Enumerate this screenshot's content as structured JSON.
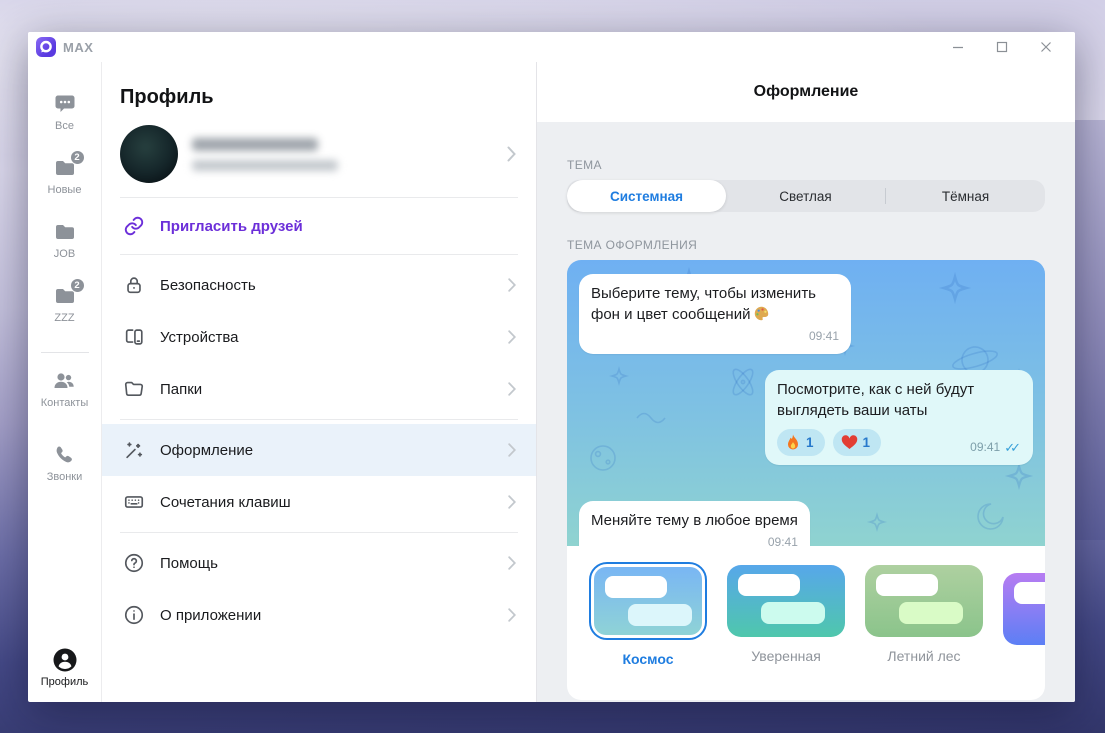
{
  "window": {
    "app_title": "MAX"
  },
  "nav_rail": {
    "items": [
      {
        "label": "Все",
        "icon": "chat-bubble-icon",
        "badge": ""
      },
      {
        "label": "Новые",
        "icon": "folder-icon",
        "badge": "2"
      },
      {
        "label": "JOB",
        "icon": "folder-icon",
        "badge": ""
      },
      {
        "label": "ZZZ",
        "icon": "folder-icon",
        "badge": "2"
      },
      {
        "label": "Контакты",
        "icon": "contacts-icon",
        "badge": ""
      },
      {
        "label": "Звонки",
        "icon": "phone-icon",
        "badge": ""
      }
    ],
    "profile_item": {
      "label": "Профиль",
      "icon": "person-circle-icon",
      "active": true
    }
  },
  "profile_panel": {
    "title": "Профиль",
    "user": {
      "name_hidden": true,
      "phone_hidden": true
    },
    "invite": {
      "label": "Пригласить друзей",
      "icon": "link-icon"
    },
    "menu": [
      {
        "label": "Безопасность",
        "icon": "lock-icon"
      },
      {
        "label": "Устройства",
        "icon": "devices-icon"
      },
      {
        "label": "Папки",
        "icon": "folder-outline-icon"
      },
      {
        "label": "Оформление",
        "icon": "magic-wand-icon",
        "active": true
      },
      {
        "label": "Сочетания клавиш",
        "icon": "keyboard-icon"
      },
      {
        "label": "Помощь",
        "icon": "help-icon"
      },
      {
        "label": "О приложении",
        "icon": "info-icon"
      }
    ]
  },
  "appearance": {
    "title": "Оформление",
    "theme_label": "ТЕМА",
    "tabs": [
      {
        "label": "Системная",
        "selected": true
      },
      {
        "label": "Светлая",
        "selected": false
      },
      {
        "label": "Тёмная",
        "selected": false
      }
    ],
    "preview_label": "ТЕМА ОФОРМЛЕНИЯ",
    "messages": [
      {
        "direction": "in",
        "text": "Выберите тему, чтобы изменить фон и цвет сообщений",
        "emoji": "🎨",
        "time": "09:41"
      },
      {
        "direction": "out",
        "text": "Посмотрите, как с ней будут выглядеть ваши чаты",
        "time": "09:41",
        "read_mark": "✓✓",
        "reactions": [
          {
            "glyph": "🔥",
            "count": "1"
          },
          {
            "glyph": "❤️",
            "count": "1"
          }
        ]
      },
      {
        "direction": "in",
        "text": "Меняйте тему в любое время",
        "time": "09:41"
      }
    ],
    "themes": [
      {
        "name": "Космос",
        "selected": true,
        "top": "#79b6f4",
        "bottom": "#8fd3d6",
        "bubble": "#dcf6fb"
      },
      {
        "name": "Уверенная",
        "selected": false,
        "top": "#57a7ea",
        "bottom": "#4fc7ac",
        "bubble": "#ccfbee"
      },
      {
        "name": "Летний лес",
        "selected": false,
        "top": "#aed0a0",
        "bottom": "#8bc48b",
        "bubble": "#d9fbc6"
      },
      {
        "name": "",
        "selected": false,
        "top": "#b77cf2",
        "bottom": "#5c7ff5",
        "bubble": "#ffffff"
      }
    ],
    "colors": {
      "accent_blue": "#1f7de0",
      "panel_bg": "#edeff2",
      "preview_top": "#6fb0f2",
      "preview_bottom": "#8fd3d0"
    }
  }
}
